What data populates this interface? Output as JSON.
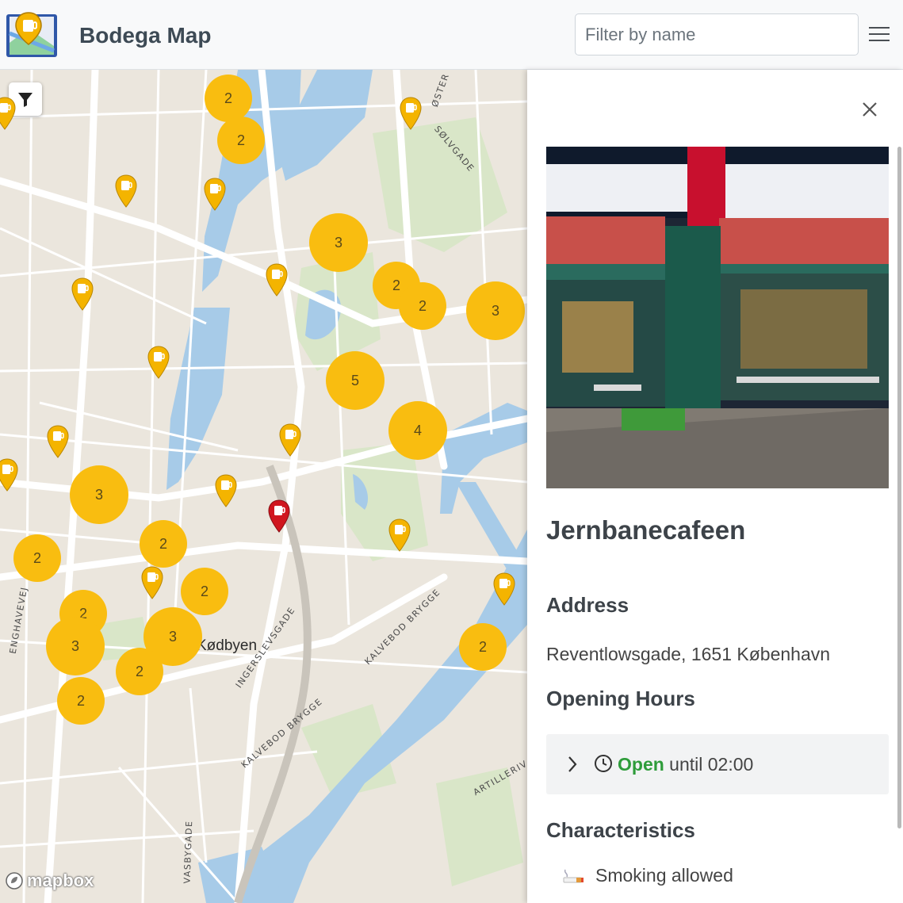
{
  "header": {
    "app_title": "Bodega Map",
    "search_placeholder": "Filter by name"
  },
  "map": {
    "clusters": [
      "2",
      "2",
      "3",
      "2",
      "2",
      "3",
      "5",
      "4",
      "3",
      "2",
      "2",
      "2",
      "2",
      "3",
      "3",
      "2",
      "2",
      "2"
    ],
    "streets": [
      "ØSTER",
      "SØLVGADE",
      "KALVEBOD BRYGGE",
      "INGERSLEVSGADE",
      "ENGHAVEVEJ",
      "KALVEBOD BRYGGE",
      "ARTILLERIV",
      "VASBYGADE"
    ],
    "district": "Kødbyen",
    "attribution": "mapbox",
    "colors": {
      "cluster": "#f9bd10",
      "pin": "#f4b400",
      "selected_pin": "#d0161f",
      "water": "#a7cbe8",
      "park": "#d9e6c8",
      "land": "#ebe6dd"
    }
  },
  "sidebar": {
    "place_name": "Jernbanecafeen",
    "address_heading": "Address",
    "address": "Reventlowsgade, 1651 København",
    "hours_heading": "Opening Hours",
    "open_status": "Open",
    "open_until": "until 02:00",
    "characteristics_heading": "Characteristics",
    "characteristics": [
      "Smoking allowed"
    ]
  }
}
